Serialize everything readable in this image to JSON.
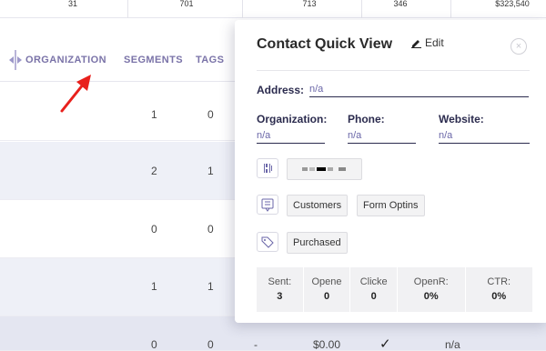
{
  "totals": [
    "31",
    "701",
    "713",
    "346",
    "$323,540"
  ],
  "header": {
    "organization": "ORGANIZATION",
    "segments": "SEGMENTS",
    "tags": "TAGS"
  },
  "rows": [
    {
      "segments": "1",
      "tags": "0"
    },
    {
      "segments": "2",
      "tags": "1"
    },
    {
      "segments": "0",
      "tags": "0"
    },
    {
      "segments": "1",
      "tags": "1"
    },
    {
      "segments": "0",
      "tags": "0",
      "dash": "-",
      "amount": "$0.00",
      "check": "✓",
      "na": "n/a"
    }
  ],
  "quickview": {
    "title": "Contact Quick View",
    "edit_label": "Edit",
    "close_glyph": "×",
    "address_label": "Address:",
    "address_value": "n/a",
    "organization_label": "Organization:",
    "organization_value": "n/a",
    "phone_label": "Phone:",
    "phone_value": "n/a",
    "website_label": "Website:",
    "website_value": "n/a",
    "lists": [
      "Customers",
      "Form Optins"
    ],
    "tags": [
      "Purchased"
    ],
    "stats": [
      {
        "key": "Sent:",
        "value": "3"
      },
      {
        "key": "Opene",
        "value": "0"
      },
      {
        "key": "Clicke",
        "value": "0"
      },
      {
        "key": "OpenR:",
        "value": "0%"
      },
      {
        "key": "CTR:",
        "value": "0%"
      }
    ]
  },
  "colors": {
    "accent": "#7a73a8",
    "arrow": "#e8201c",
    "alt_row": "#eef0f7"
  }
}
